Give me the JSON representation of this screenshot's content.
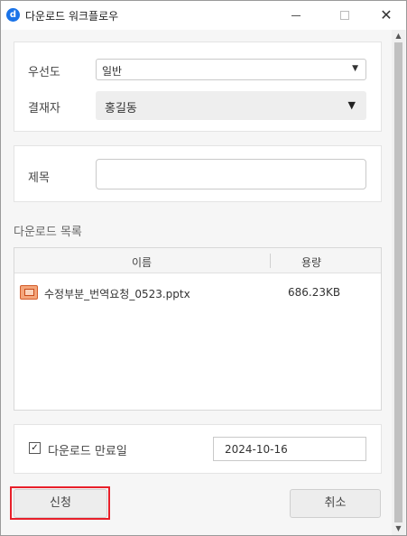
{
  "window": {
    "title": "다운로드 워크플로우",
    "icon_letter": "d",
    "icon_color": "#1a73e8",
    "controls": {
      "minimize": "minimize-icon",
      "maximize": "maximize-icon",
      "close": "✕"
    }
  },
  "form": {
    "priority": {
      "label": "우선도",
      "value": "일반",
      "arrow": "▼"
    },
    "approver": {
      "label": "결재자",
      "value": "홍길동",
      "arrow": "▼"
    },
    "subject": {
      "label": "제목",
      "value": ""
    }
  },
  "download_list": {
    "title": "다운로드 목록",
    "columns": {
      "name": "이름",
      "size": "용량"
    },
    "files": [
      {
        "name": "수정부분_번역요청_0523.pptx",
        "size": "686.23KB",
        "icon": "pptx-file-icon"
      }
    ]
  },
  "expiry": {
    "checked": true,
    "check_mark": "✓",
    "label": "다운로드 만료일",
    "date": "2024-10-16"
  },
  "buttons": {
    "apply": "신청",
    "cancel": "취소"
  },
  "highlight_color": "#e8202a",
  "scrollbar": {
    "up": "▲",
    "down": "▼"
  }
}
